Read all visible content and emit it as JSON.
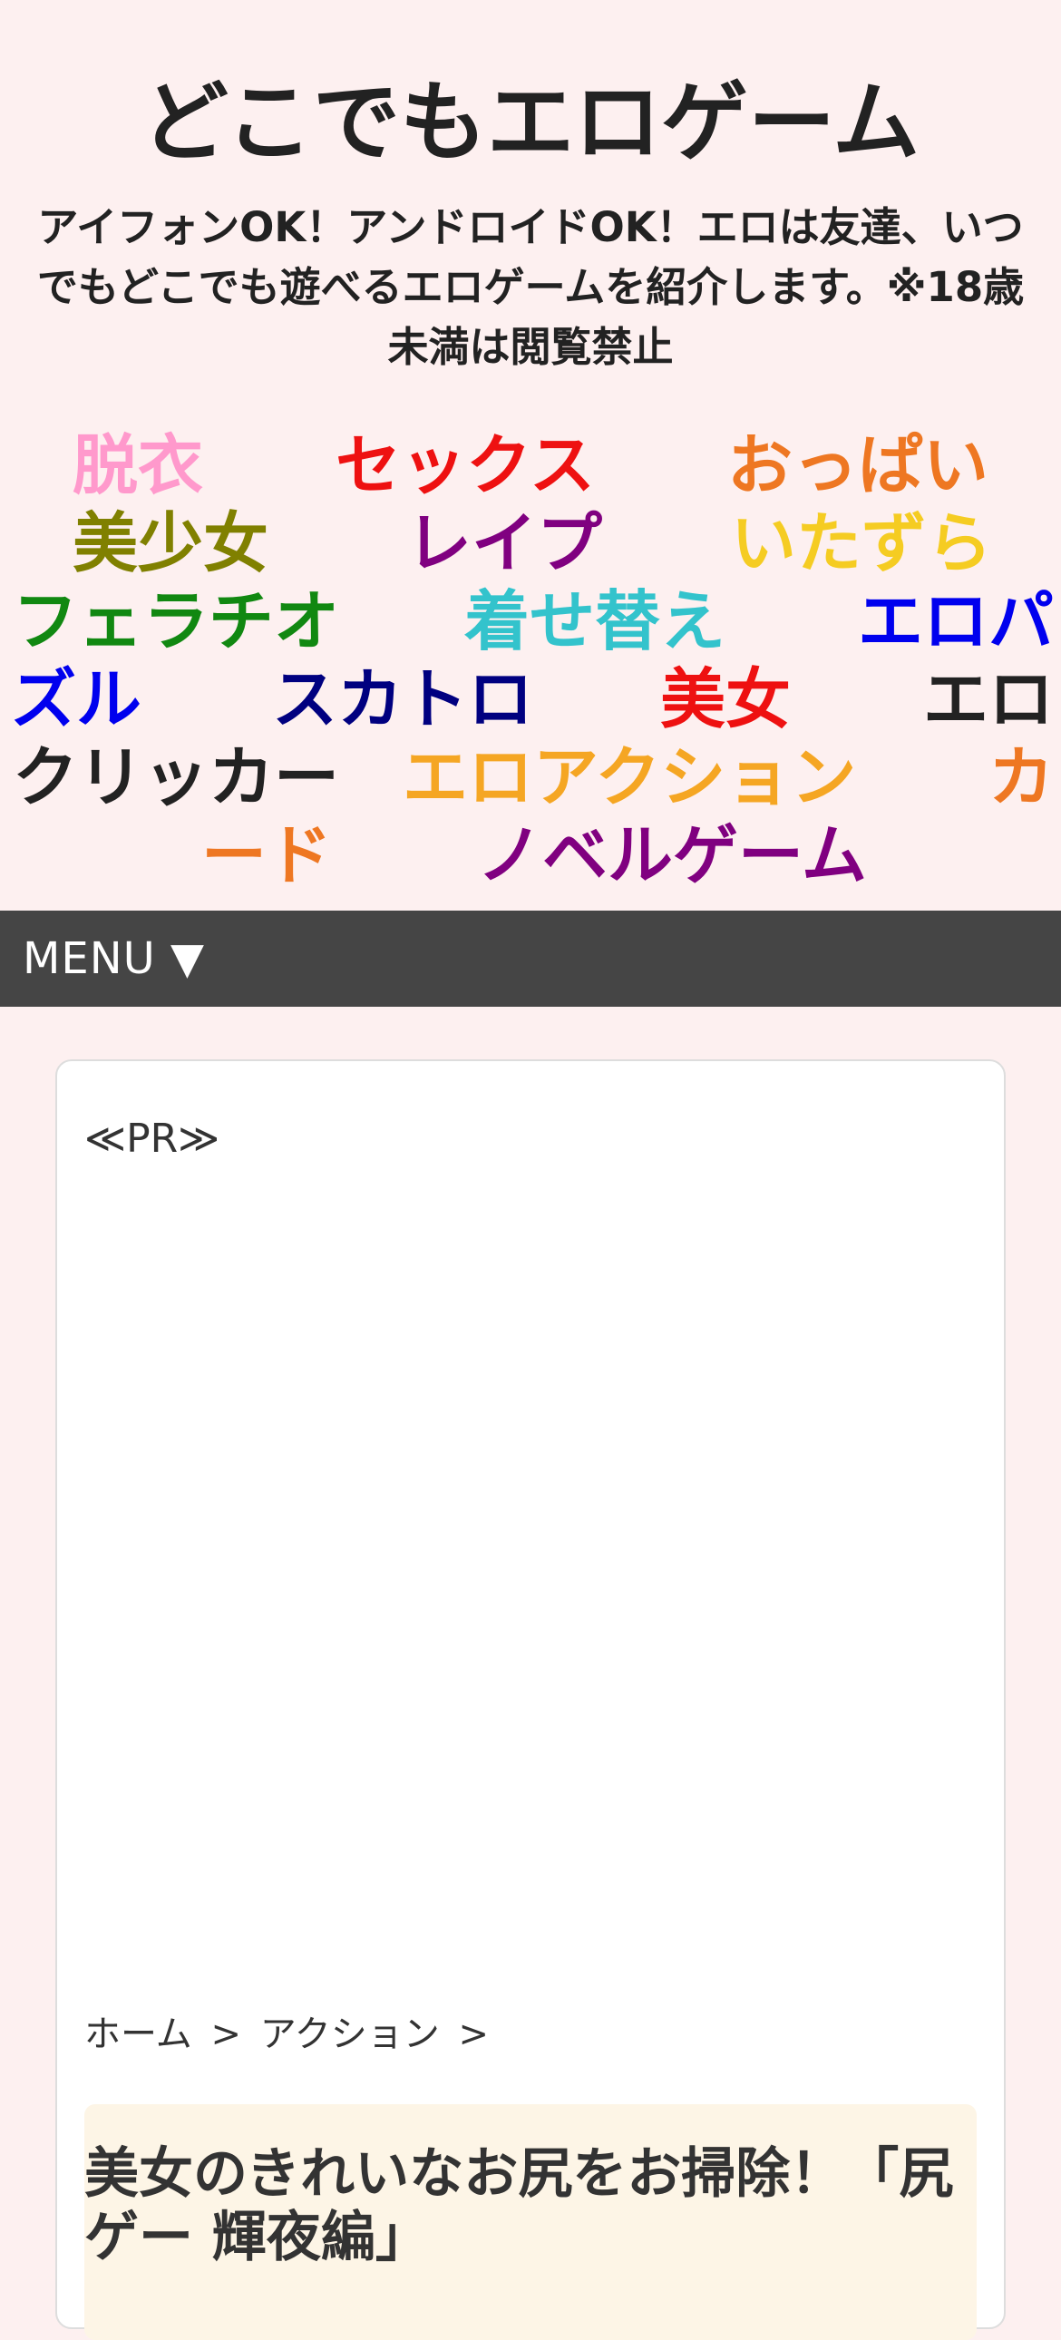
{
  "header": {
    "title": "どこでもエロゲーム",
    "desc_line1": "アイフォンOK！アンドロイドOK！エロは友達、いつ",
    "desc_line2": "でもどこでも遊べるエロゲームを紹介します。※18歳",
    "desc_line3": "未満は閲覧禁止"
  },
  "tags": [
    {
      "label": "脱衣",
      "color": "#ff99cc"
    },
    {
      "label": "セックス",
      "color": "#ee1111"
    },
    {
      "label": "おっぱい",
      "color": "#ee7722"
    },
    {
      "label": "美少女",
      "color": "#808000"
    },
    {
      "label": "レイプ",
      "color": "#800080"
    },
    {
      "label": "いたずら",
      "color": "#f5cc22"
    },
    {
      "label": "フェラチオ",
      "color": "#118811"
    },
    {
      "label": "着せ替え",
      "color": "#33c3cc"
    },
    {
      "label": "エロパ",
      "color": "#0000ee"
    },
    {
      "label": "ズル",
      "color": "#0000ee"
    },
    {
      "label": "スカトロ",
      "color": "#000080"
    },
    {
      "label": "美女",
      "color": "#ee1111"
    },
    {
      "label": "エロ",
      "color": "#222222"
    },
    {
      "label": "クリッカー",
      "color": "#222222"
    },
    {
      "label": "エロアクション",
      "color": "#f5a623"
    },
    {
      "label": "カ",
      "color": "#ee7722"
    },
    {
      "label": "ード",
      "color": "#ee7722"
    },
    {
      "label": "ノベルゲーム",
      "color": "#800080"
    }
  ],
  "menu": {
    "label": "MENU ▼"
  },
  "content": {
    "pr_label": "≪PR≫",
    "breadcrumb": {
      "home": "ホーム",
      "sep1": ">",
      "category": "アクション",
      "sep2": ">"
    },
    "post_title_line1": "美女のきれいなお尻をお掃除！「尻",
    "post_title_line2": "ゲー 輝夜編」"
  }
}
